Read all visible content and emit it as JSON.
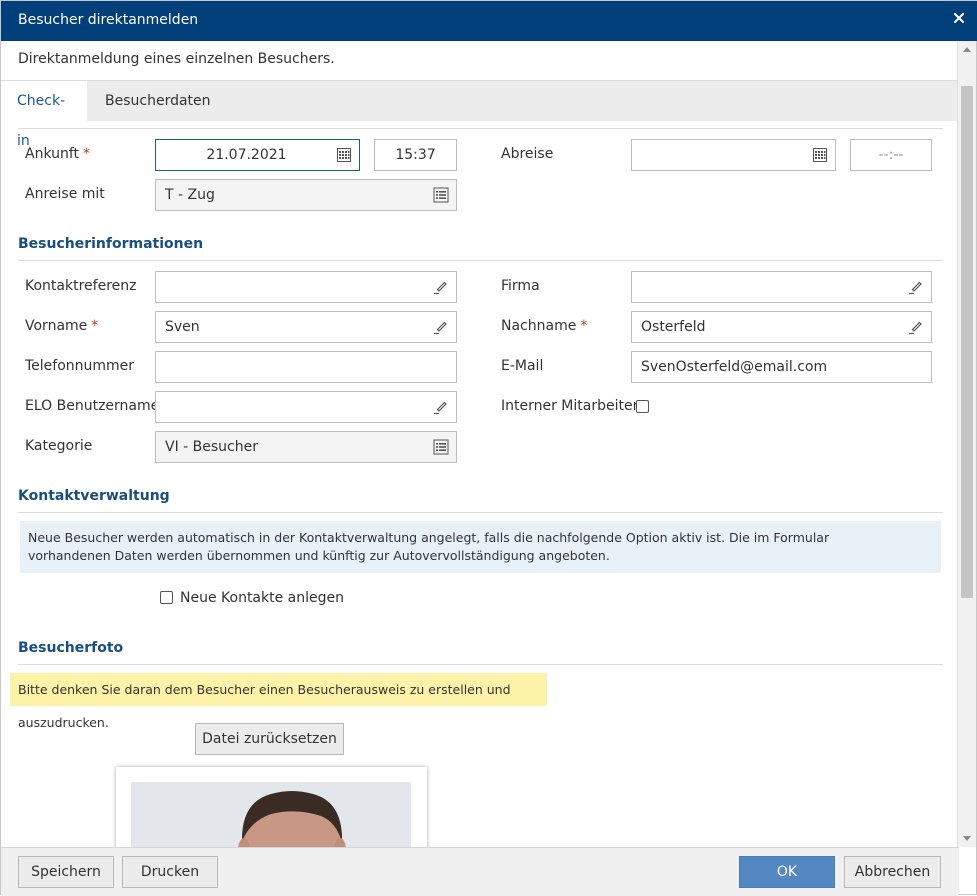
{
  "dialog": {
    "title": "Besucher direktanmelden",
    "subtitle": "Direktanmeldung eines einzelnen Besuchers."
  },
  "tabs": [
    {
      "label": "Check-in",
      "active": true
    },
    {
      "label": "Besucherdaten",
      "active": false
    }
  ],
  "checkin": {
    "arrival_label": "Ankunft",
    "arrival_date": "21.07.2021",
    "arrival_time": "15:37",
    "departure_label": "Abreise",
    "departure_date": "",
    "departure_time_placeholder": "--:--",
    "travel_label": "Anreise mit",
    "travel_value": "T - Zug",
    "required_mark": "*"
  },
  "visitor_info": {
    "section_title": "Besucherinformationen",
    "contact_ref_label": "Kontaktreferenz",
    "contact_ref_value": "",
    "company_label": "Firma",
    "company_value": "",
    "firstname_label": "Vorname",
    "firstname_value": "Sven",
    "lastname_label": "Nachname",
    "lastname_value": "Osterfeld",
    "phone_label": "Telefonnummer",
    "phone_value": "",
    "email_label": "E-Mail",
    "email_value": "SvenOsterfeld@email.com",
    "elo_user_label": "ELO Benutzername",
    "elo_user_value": "",
    "internal_label": "Interner Mitarbeiter",
    "internal_checked": false,
    "category_label": "Kategorie",
    "category_value": "VI - Besucher"
  },
  "contact_mgmt": {
    "section_title": "Kontaktverwaltung",
    "info_line1": "Neue Besucher werden automatisch in der Kontaktverwaltung angelegt, falls die nachfolgende Option aktiv ist. Die im Formular",
    "info_line2": "vorhandenen Daten werden übernommen und künftig zur Autovervollständigung angeboten.",
    "create_contacts_label": "Neue Kontakte anlegen",
    "create_contacts_checked": false
  },
  "photo": {
    "section_title": "Besucherfoto",
    "warning": "Bitte denken Sie daran dem Besucher einen Besucherausweis zu erstellen und auszudrucken.",
    "reset_button": "Datei zurücksetzen"
  },
  "footer": {
    "save": "Speichern",
    "print": "Drucken",
    "ok": "OK",
    "cancel": "Abbrechen"
  },
  "icons": {
    "calendar": "calendar-icon",
    "list": "list-icon",
    "edit": "pencil-icon",
    "close": "close-icon"
  },
  "colors": {
    "titlebar": "#003f79",
    "section_title": "#1a4d80",
    "required": "#c0392b",
    "info_bg": "#e8f1f8",
    "warning_bg": "#fdf3a8",
    "primary_button": "#5588c2"
  }
}
